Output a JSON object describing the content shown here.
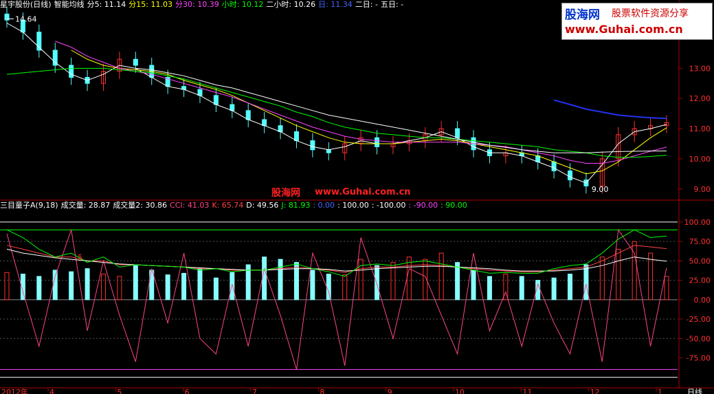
{
  "header_top": {
    "stock": "星宇股份(日线)",
    "indicator": "智能均线",
    "items": [
      {
        "label": "分5: 11.14",
        "color": "#ffffff"
      },
      {
        "label": "分15: 11.03",
        "color": "#ffff00"
      },
      {
        "label": "分30: 10.39",
        "color": "#ff44ff"
      },
      {
        "label": "小时: 10.12",
        "color": "#00ff00"
      },
      {
        "label": "二小时: 10.26",
        "color": "#ffffff"
      },
      {
        "label": "日: 11.34",
        "color": "#4466ff"
      },
      {
        "label": "二日: -",
        "color": "#ffffff"
      },
      {
        "label": "五日: -",
        "color": "#ffffff"
      }
    ]
  },
  "header_bottom": {
    "indicator": "三目童子A(9,18)",
    "items": [
      {
        "label": "成交量: 28.87",
        "color": "#ffffff"
      },
      {
        "label": "成交量2: 30.86",
        "color": "#ffffff"
      },
      {
        "label": "CCI: 41.03",
        "color": "#ff4488"
      },
      {
        "label": "K: 65.74",
        "color": "#ff4444"
      },
      {
        "label": "D: 49.56",
        "color": "#ffffff"
      },
      {
        "label": "J: 81.93",
        "color": "#00ff00"
      },
      {
        "label": ": 0.00",
        "color": "#4466ff"
      },
      {
        "label": ": 100.00",
        "color": "#ffffff"
      },
      {
        "label": ": -100.00",
        "color": "#ffffff"
      },
      {
        "label": ": -90.00",
        "color": "#ff44ff"
      },
      {
        "label": ": 90.00",
        "color": "#00ff00"
      }
    ]
  },
  "logo": {
    "line1": "股海网",
    "line1b": "股票软件资源分享",
    "line2": "www.Guhai.com.cn"
  },
  "watermark": {
    "left": "股海网",
    "right": "www.Guhai.com.cn"
  },
  "price_annotations": {
    "high": "14.64",
    "low": "9.00"
  },
  "signal_marker": "$",
  "bottom_axis": {
    "start": "2012年",
    "months": [
      "4",
      "5",
      "6",
      "7",
      "8",
      "9",
      "10",
      "11",
      "12",
      "1"
    ],
    "right_label": "日线"
  },
  "chart_data": [
    {
      "type": "line",
      "panel": "price",
      "ylim": [
        8.7,
        14.9
      ],
      "yticks": [
        9.0,
        10.0,
        11.0,
        12.0,
        13.0
      ],
      "ytick_labels": [
        "9.00",
        "10.00",
        "11.00",
        "12.00",
        "13.00"
      ],
      "grid": false,
      "close_approx": [
        14.6,
        14.2,
        13.6,
        13.1,
        12.7,
        12.5,
        12.9,
        13.3,
        13.1,
        12.7,
        12.4,
        12.3,
        12.1,
        11.8,
        11.6,
        11.3,
        11.1,
        10.9,
        10.6,
        10.3,
        10.2,
        10.5,
        10.7,
        10.4,
        10.5,
        10.6,
        10.8,
        11.0,
        10.7,
        10.3,
        10.1,
        10.2,
        10.1,
        9.9,
        9.6,
        9.3,
        9.1,
        10.0,
        10.8,
        11.0,
        11.1,
        11.2
      ],
      "series": [
        {
          "name": "分5",
          "color": "#ffffff",
          "values": [
            14.5,
            14.2,
            13.7,
            13.2,
            12.8,
            12.6,
            12.8,
            13.1,
            13.0,
            12.7,
            12.4,
            12.3,
            12.1,
            11.8,
            11.6,
            11.3,
            11.1,
            10.9,
            10.6,
            10.4,
            10.3,
            10.4,
            10.6,
            10.5,
            10.5,
            10.6,
            10.7,
            10.9,
            10.7,
            10.4,
            10.2,
            10.2,
            10.1,
            9.9,
            9.7,
            9.4,
            9.2,
            9.8,
            10.5,
            10.9,
            11.0,
            11.14
          ]
        },
        {
          "name": "分15",
          "color": "#ffff00",
          "values": [
            null,
            null,
            null,
            null,
            13.6,
            13.3,
            13.1,
            13.0,
            12.95,
            12.9,
            12.8,
            12.6,
            12.45,
            12.3,
            12.1,
            11.85,
            11.6,
            11.35,
            11.1,
            10.9,
            10.7,
            10.55,
            10.5,
            10.5,
            10.5,
            10.55,
            10.6,
            10.65,
            10.6,
            10.5,
            10.4,
            10.3,
            10.2,
            10.1,
            9.9,
            9.7,
            9.5,
            9.6,
            9.9,
            10.3,
            10.7,
            11.03
          ]
        },
        {
          "name": "分30",
          "color": "#ff44ff",
          "values": [
            null,
            null,
            null,
            13.9,
            13.7,
            13.4,
            13.2,
            13.0,
            12.9,
            12.8,
            12.65,
            12.5,
            12.35,
            12.2,
            12.05,
            11.85,
            11.65,
            11.45,
            11.25,
            11.05,
            10.9,
            10.75,
            10.65,
            10.6,
            10.55,
            10.55,
            10.55,
            10.55,
            10.55,
            10.5,
            10.45,
            10.4,
            10.3,
            10.2,
            10.1,
            9.95,
            9.85,
            9.85,
            9.95,
            10.1,
            10.25,
            10.39
          ]
        },
        {
          "name": "小时",
          "color": "#00ff00",
          "values": [
            12.8,
            12.85,
            12.9,
            12.95,
            13.0,
            13.0,
            13.0,
            12.95,
            12.9,
            12.85,
            12.75,
            12.65,
            12.5,
            12.35,
            12.2,
            12.05,
            11.9,
            11.75,
            11.55,
            11.4,
            11.2,
            11.05,
            10.95,
            10.85,
            10.8,
            10.75,
            10.7,
            10.7,
            10.65,
            10.6,
            10.55,
            10.5,
            10.45,
            10.4,
            10.3,
            10.25,
            10.2,
            10.1,
            10.05,
            10.05,
            10.08,
            10.12
          ]
        },
        {
          "name": "二小时",
          "color": "#ffffff",
          "values": [
            null,
            null,
            null,
            null,
            null,
            null,
            null,
            null,
            13.0,
            12.95,
            12.85,
            12.75,
            12.6,
            12.45,
            12.35,
            12.2,
            12.05,
            11.9,
            11.75,
            11.6,
            11.45,
            11.35,
            11.25,
            11.15,
            11.05,
            10.95,
            10.85,
            10.75,
            10.65,
            10.55,
            10.45,
            10.38,
            10.3,
            10.25,
            10.2,
            10.2,
            10.2,
            10.22,
            10.24,
            10.25,
            10.26,
            10.26
          ]
        },
        {
          "name": "日",
          "color": "#2233ee",
          "values": [
            null,
            null,
            null,
            null,
            null,
            null,
            null,
            null,
            null,
            null,
            null,
            null,
            null,
            null,
            null,
            null,
            null,
            null,
            null,
            null,
            null,
            null,
            null,
            null,
            null,
            null,
            null,
            null,
            null,
            null,
            null,
            null,
            null,
            null,
            11.95,
            11.8,
            11.65,
            11.55,
            11.45,
            11.4,
            11.36,
            11.34
          ]
        }
      ]
    },
    {
      "type": "bar",
      "panel": "indicator",
      "ylim": [
        -110,
        115
      ],
      "yticks": [
        100,
        75,
        50,
        25,
        0,
        -25,
        -50,
        -75
      ],
      "ytick_labels": [
        "100.00",
        "75.00",
        "50.00",
        "25.00",
        "0.00",
        "-25.00",
        "-50.00",
        "-75.00"
      ],
      "hlines": [
        {
          "value": 100,
          "color": "#ffffff"
        },
        {
          "value": 90,
          "color": "#00ff00"
        },
        {
          "value": -90,
          "color": "#ff44ff"
        },
        {
          "value": -100,
          "color": "#ffffff"
        }
      ],
      "series": [
        {
          "name": "成交量",
          "color": "#88ffff",
          "values": [
            35,
            33,
            30,
            38,
            36,
            40,
            33,
            30,
            44,
            38,
            32,
            34,
            40,
            28,
            35,
            45,
            55,
            52,
            48,
            38,
            33,
            32,
            52,
            44,
            48,
            55,
            52,
            60,
            48,
            38,
            30,
            33,
            30,
            25,
            28,
            33,
            45,
            55,
            65,
            75,
            60,
            30
          ]
        },
        {
          "name": "CCI",
          "color": "#ff4488",
          "values": [
            85,
            10,
            -60,
            30,
            90,
            -40,
            50,
            -20,
            -80,
            40,
            -30,
            60,
            -50,
            -70,
            20,
            -60,
            40,
            -20,
            -90,
            60,
            10,
            -85,
            80,
            20,
            -50,
            40,
            30,
            -20,
            -70,
            60,
            -40,
            10,
            -60,
            20,
            -30,
            -70,
            20,
            -80,
            90,
            60,
            -60,
            41
          ]
        },
        {
          "name": "K",
          "color": "#ff4444",
          "values": [
            70,
            65,
            60,
            55,
            55,
            50,
            50,
            45,
            45,
            44,
            43,
            42,
            40,
            40,
            38,
            38,
            38,
            40,
            42,
            40,
            38,
            35,
            40,
            42,
            42,
            44,
            45,
            44,
            42,
            40,
            38,
            37,
            36,
            36,
            38,
            40,
            42,
            50,
            60,
            70,
            68,
            65.74
          ]
        },
        {
          "name": "D",
          "color": "#ffffff",
          "values": [
            65,
            60,
            57,
            54,
            52,
            50,
            48,
            46,
            45,
            44,
            43,
            42,
            41,
            40,
            39,
            38,
            38,
            39,
            40,
            40,
            39,
            37,
            38,
            40,
            41,
            42,
            43,
            43,
            42,
            41,
            40,
            38,
            37,
            37,
            37,
            38,
            40,
            44,
            50,
            55,
            52,
            49.56
          ]
        },
        {
          "name": "J",
          "color": "#00ff00",
          "values": [
            90,
            80,
            65,
            55,
            60,
            48,
            55,
            42,
            45,
            44,
            43,
            42,
            38,
            40,
            36,
            38,
            38,
            42,
            46,
            40,
            36,
            30,
            44,
            46,
            44,
            48,
            50,
            46,
            42,
            38,
            34,
            35,
            34,
            34,
            40,
            44,
            46,
            60,
            78,
            90,
            80,
            81.93
          ]
        }
      ]
    }
  ]
}
